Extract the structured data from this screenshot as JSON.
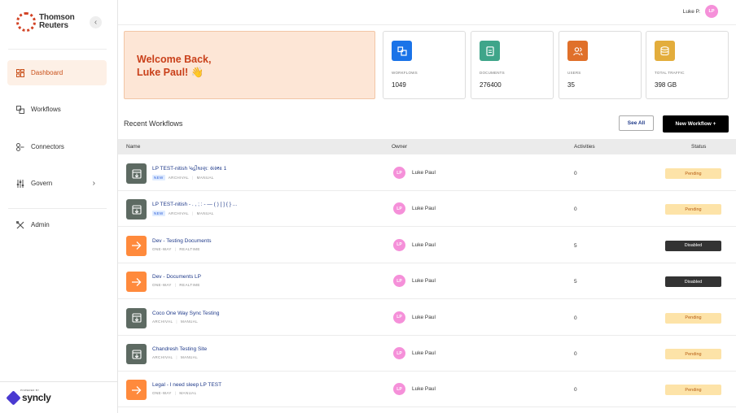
{
  "brand": {
    "line1": "Thomson",
    "line2": "Reuters"
  },
  "sidebar": {
    "collapse_icon": "chevron-left-icon",
    "items": [
      {
        "label": "Dashboard",
        "icon": "grid-icon",
        "active": true
      },
      {
        "label": "Workflows",
        "icon": "workflow-icon"
      },
      {
        "label": "Connectors",
        "icon": "connector-icon"
      },
      {
        "label": "Govern",
        "icon": "sliders-icon",
        "has_chevron": true
      },
      {
        "label": "Admin",
        "icon": "tools-icon"
      }
    ],
    "powered_by": "POWERED BY",
    "powered_brand": "syncly"
  },
  "header": {
    "user_name": "Luke P.",
    "user_initials": "LP"
  },
  "welcome": {
    "line1": "Welcome Back,",
    "line2": "Luke Paul! 👋"
  },
  "stats": [
    {
      "label": "WORKFLOWS",
      "value": "1049",
      "color": "#1a73e8",
      "icon": "workflows-icon"
    },
    {
      "label": "DOCUMENTS",
      "value": "276400",
      "color": "#3fa58a",
      "icon": "document-icon"
    },
    {
      "label": "USERS",
      "value": "35",
      "color": "#e0702a",
      "icon": "users-icon"
    },
    {
      "label": "TOTAL TRAFFIC",
      "value": "398 GB",
      "color": "#e3ad3c",
      "icon": "database-icon"
    }
  ],
  "recent": {
    "title": "Recent Workflows",
    "see_all": "See All",
    "new_workflow": "New Workflow +"
  },
  "table": {
    "columns": {
      "name": "Name",
      "owner": "Owner",
      "activities": "Activities",
      "status": "Status"
    },
    "rows": [
      {
        "name": "LP TEST-nitish પહીઘાણ: સંસ્થા 1",
        "kind": "archival",
        "tags": [
          "NEW",
          "ARCHIVAL",
          "MANUAL"
        ],
        "owner": "Luke Paul",
        "initials": "LP",
        "activities": "0",
        "status": "Pending"
      },
      {
        "name": "LP TEST-nitish - . , ; : - — ( ) [ ] { } ...",
        "kind": "archival",
        "tags": [
          "NEW",
          "ARCHIVAL",
          "MANUAL"
        ],
        "owner": "Luke Paul",
        "initials": "LP",
        "activities": "0",
        "status": "Pending"
      },
      {
        "name": "Dev - Testing Documents",
        "kind": "oneway",
        "tags": [
          "ONE-WAY",
          "REALTIME"
        ],
        "owner": "Luke Paul",
        "initials": "LP",
        "activities": "5",
        "status": "Disabled"
      },
      {
        "name": "Dev - Documents LP",
        "kind": "oneway",
        "tags": [
          "ONE-WAY",
          "REALTIME"
        ],
        "owner": "Luke Paul",
        "initials": "LP",
        "activities": "5",
        "status": "Disabled"
      },
      {
        "name": "Coco One Way Sync Testing",
        "kind": "archival",
        "tags": [
          "ARCHIVAL",
          "MANUAL"
        ],
        "owner": "Luke Paul",
        "initials": "LP",
        "activities": "0",
        "status": "Pending"
      },
      {
        "name": "Chandresh Testing Site",
        "kind": "archival",
        "tags": [
          "ARCHIVAL",
          "MANUAL"
        ],
        "owner": "Luke Paul",
        "initials": "LP",
        "activities": "0",
        "status": "Pending"
      },
      {
        "name": "Legal - I need sleep LP TEST",
        "kind": "oneway",
        "tags": [
          "ONE-WAY",
          "MANUAL"
        ],
        "owner": "Luke Paul",
        "initials": "LP",
        "activities": "0",
        "status": "Pending"
      }
    ]
  }
}
